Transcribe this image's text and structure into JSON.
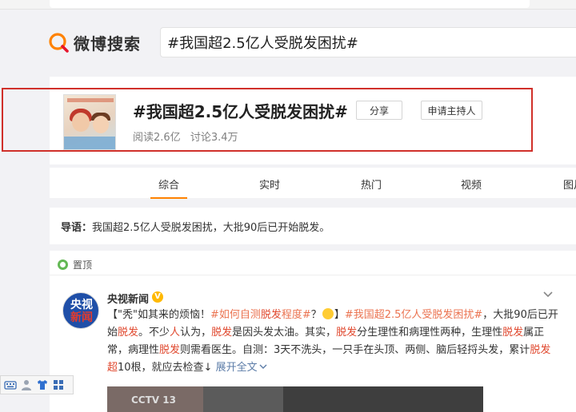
{
  "logo": {
    "text": "微博搜索"
  },
  "search": {
    "value": "#我国超2.5亿人受脱发困扰#"
  },
  "topic": {
    "title": "#我国超2.5亿人受脱发困扰#",
    "share_label": "分享",
    "host_label": "申请主持人",
    "reads": "阅读2.6亿",
    "discussions": "讨论3.4万"
  },
  "tabs": [
    {
      "label": "综合",
      "active": true
    },
    {
      "label": "实时"
    },
    {
      "label": "热门"
    },
    {
      "label": "视频"
    },
    {
      "label": "图片"
    }
  ],
  "guide": {
    "label": "导语：",
    "text": "我国超2.5亿人受脱发困扰，大批90后已开始脱发。"
  },
  "pinned": {
    "label": "置顶"
  },
  "post": {
    "author": "央视新闻",
    "avatar_line1": "央视",
    "avatar_line2": "新闻",
    "seg1": "【\"秃\"如其来的烦恼！",
    "tag1": "#如何自测",
    "tag1_hl": "脱发",
    "tag1_end": "程度#",
    "seg2": "？",
    "seg3": "】",
    "tag2": "#我国超2.5亿人受脱发困扰#",
    "seg4": "，大批90后已开始",
    "hl1": "脱发",
    "seg5": "。不少",
    "hl2": "人",
    "seg6": "认为，",
    "hl3": "脱发",
    "seg7": "是因头发太油。其实，",
    "hl4": "脱发",
    "seg8": "分生理性和病理性两种，生理性",
    "hl5": "脱发",
    "seg9": "属正常，病理性",
    "hl6": "脱发",
    "seg10": "则需看医生。自测：3天不洗头，一只手在头顶、两侧、脑后轻捋头发，累计",
    "hl7": "脱发",
    "hl8": "超",
    "seg11": "10根，就应去检查↓",
    "expand": "展开全文",
    "video_logo": "CCTV 13"
  },
  "colors": {
    "accent": "#ff8200",
    "frame": "#d0302a",
    "link": "#eb7350",
    "highlight": "#e0482e"
  }
}
